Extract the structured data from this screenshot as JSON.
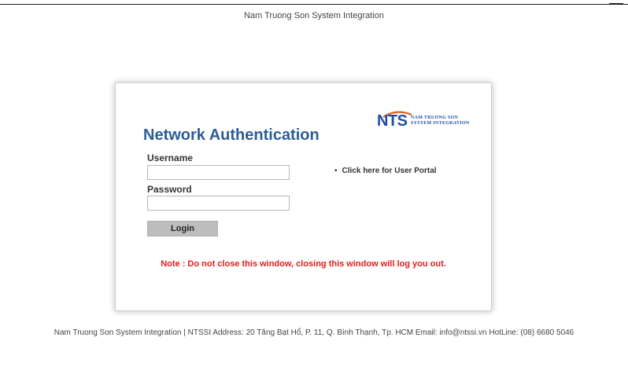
{
  "header": {
    "title": "Nam Truong Son System Integration"
  },
  "logo": {
    "mark": "NTS",
    "company_line1": "NAM TRUONG SON",
    "company_line2": "SYSTEM INTEGRATION",
    "color": "#1f4fa0",
    "accent_color": "#e35b1e"
  },
  "form": {
    "title": "Network Authentication",
    "username_label": "Username",
    "username_value": "",
    "password_label": "Password",
    "password_value": "",
    "login_label": "Login"
  },
  "portal_link": {
    "label": "Click here for User Portal"
  },
  "note": "Note : Do not close this window, closing this window will log you out.",
  "footer": "Nam Truong Son System Integration | NTSSI Address: 20 Tăng Bạt Hổ, P. 11, Q. Bình Thạnh, Tp. HCM Email: info@ntssi.vn HotLine: (08) 6680 5046",
  "colors": {
    "title": "#2d5c9a",
    "note": "#e31b1b",
    "button_bg": "#bdbdbd"
  }
}
